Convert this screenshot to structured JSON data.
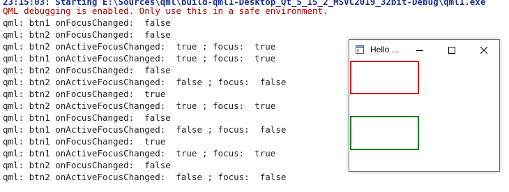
{
  "console": {
    "lines": [
      {
        "text": "23:15:03: Starting E:\\Sources\\qml\\build-qml1-Desktop_Qt_5_15_2_MSVC2019_32bit-Debug\\qml1.exe",
        "kind": "status"
      },
      {
        "text": "QML debugging is enabled. Only use this in a safe environment.",
        "kind": "warning"
      },
      {
        "text": "qml: btn1 onFocusChanged:  false",
        "kind": "log"
      },
      {
        "text": "qml: btn2 onFocusChanged:  false",
        "kind": "log"
      },
      {
        "text": "qml: btn2 onActiveFocusChanged:  true ; focus:  true",
        "kind": "log"
      },
      {
        "text": "qml: btn1 onActiveFocusChanged:  true ; focus:  true",
        "kind": "log"
      },
      {
        "text": "qml: btn2 onFocusChanged:  false",
        "kind": "log"
      },
      {
        "text": "qml: btn2 onActiveFocusChanged:  false ; focus:  false",
        "kind": "log"
      },
      {
        "text": "qml: btn2 onFocusChanged:  true",
        "kind": "log"
      },
      {
        "text": "qml: btn2 onActiveFocusChanged:  true ; focus:  true",
        "kind": "log"
      },
      {
        "text": "qml: btn1 onFocusChanged:  false",
        "kind": "log"
      },
      {
        "text": "qml: btn1 onActiveFocusChanged:  false ; focus:  false",
        "kind": "log"
      },
      {
        "text": "qml: btn1 onFocusChanged:  true",
        "kind": "log"
      },
      {
        "text": "qml: btn1 onActiveFocusChanged:  true ; focus:  true",
        "kind": "log"
      },
      {
        "text": "qml: btn2 onFocusChanged:  false",
        "kind": "log"
      },
      {
        "text": "qml: btn2 onActiveFocusChanged:  false ; focus:  false",
        "kind": "log"
      }
    ]
  },
  "window": {
    "title": "Hello ...",
    "icon": "app-window-icon",
    "controls": {
      "minimize_icon": "minimize-icon",
      "maximize_icon": "maximize-icon",
      "close_icon": "close-icon"
    },
    "focus_boxes": [
      {
        "name": "btn1",
        "border_color": "#d81b1b"
      },
      {
        "name": "btn2",
        "border_color": "#1a7f1a"
      }
    ]
  },
  "colors": {
    "status_text": "#1c2f8c",
    "warning_text": "#b00000",
    "log_text": "#222222"
  }
}
